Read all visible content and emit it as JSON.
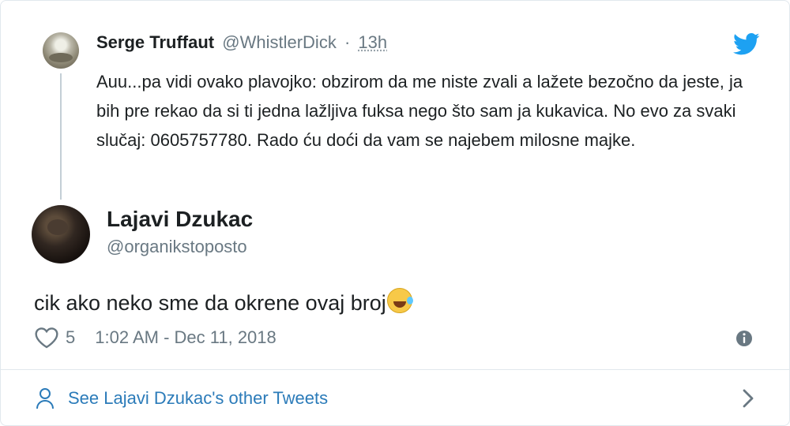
{
  "quoted_tweet": {
    "author_name": "Serge Truffaut",
    "author_handle": "@WhistlerDick",
    "separator": "·",
    "time": "13h",
    "text": "Auu...pa vidi ovako plavojko: obzirom da me niste zvali a lažete bezočno da jeste, ja bih pre rekao da si ti jedna lažljiva fuksa nego što sam ja kukavica. No evo za svaki slučaj: 0605757780. Rado ću doći da vam se najebem milosne majke."
  },
  "tweet": {
    "author_name": "Lajavi Dzukac",
    "author_handle": "@organikstoposto",
    "text": "cik ako neko sme da okrene ovaj broj",
    "emoji": "rolling-on-the-floor-laughing",
    "like_count": "5",
    "timestamp": "1:02 AM - Dec 11, 2018"
  },
  "footer": {
    "link_label": "See Lajavi Dzukac's other Tweets"
  },
  "colors": {
    "twitter_blue": "#1da1f2",
    "link_blue": "#2b7bb9",
    "muted_gray": "#697882",
    "divider": "#e1e8ed"
  },
  "icons": [
    "twitter-bird-icon",
    "heart-icon",
    "info-icon",
    "person-icon",
    "chevron-right-icon"
  ]
}
